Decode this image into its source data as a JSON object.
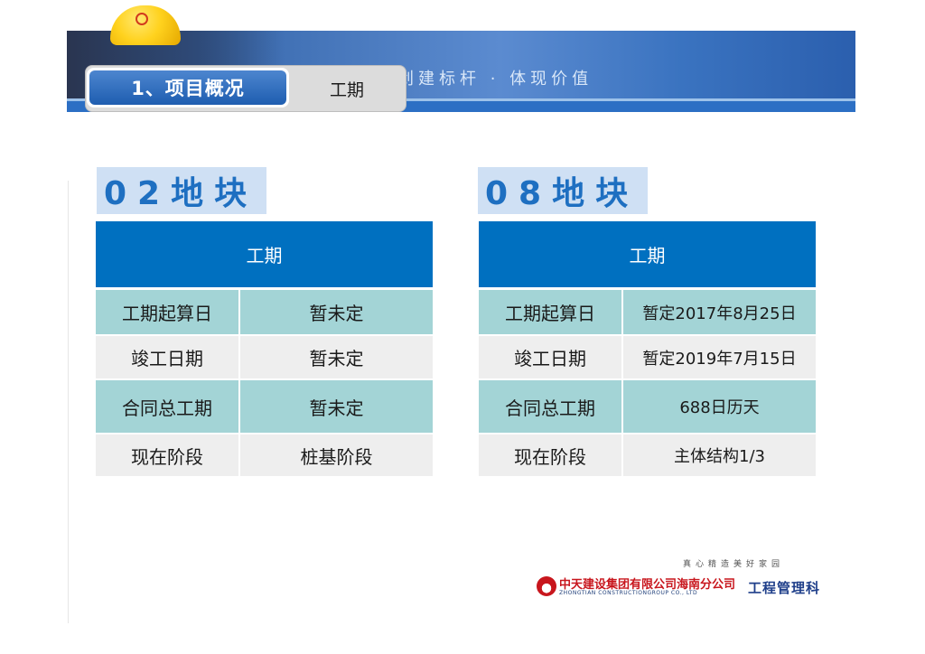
{
  "header": {
    "slogan": "创建标杆 · 体现价值",
    "tabs": [
      {
        "label": "1、项目概况",
        "active": true
      },
      {
        "label": "工期",
        "active": false
      }
    ]
  },
  "sections": [
    {
      "heading": "02地块",
      "table_header": "工期",
      "rows": [
        {
          "label": "工期起算日",
          "value": "暂未定"
        },
        {
          "label": "竣工日期",
          "value": "暂未定"
        },
        {
          "label": "合同总工期",
          "value": "暂未定"
        },
        {
          "label": "现在阶段",
          "value": "桩基阶段"
        }
      ]
    },
    {
      "heading": "08地块",
      "table_header": "工期",
      "rows": [
        {
          "label": "工期起算日",
          "value": "暂定2017年8月25日"
        },
        {
          "label": "竣工日期",
          "value": "暂定2019年7月15日"
        },
        {
          "label": "合同总工期",
          "value": "688日历天"
        },
        {
          "label": "现在阶段",
          "value": "主体结构1/3"
        }
      ]
    }
  ],
  "footer": {
    "motto": "真心精造美好家园",
    "company_cn": "中天建设集团有限公司海南分公司",
    "company_en": "ZHONGTIAN CONSTRUCTIONGROUP CO., LTD",
    "department": "工程管理科"
  },
  "colors": {
    "header_blue": "#0070c0",
    "row_teal": "#a3d4d6",
    "row_gray": "#eeeeee",
    "heading_text": "#1e6fc1",
    "brand_red": "#c8161d"
  }
}
